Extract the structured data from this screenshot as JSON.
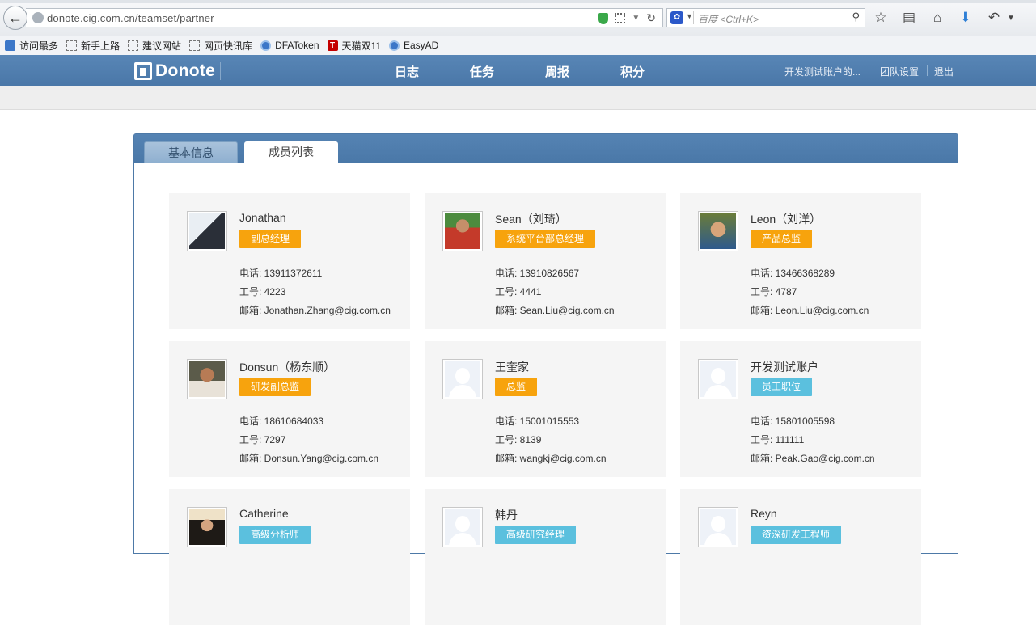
{
  "browser": {
    "url": "donote.cig.com.cn/teamset/partner",
    "search_placeholder": "百度 <Ctrl+K>"
  },
  "bookmarks": [
    "访问最多",
    "新手上路",
    "建议网站",
    "网页快讯库",
    "DFAToken",
    "天猫双11",
    "EasyAD"
  ],
  "nav": {
    "logo": "Donote",
    "items": [
      "日志",
      "任务",
      "周报",
      "积分"
    ],
    "account": "开发测试账户的...",
    "team_settings": "团队设置",
    "logout": "退出"
  },
  "tabs": {
    "basic_info": "基本信息",
    "member_list": "成员列表"
  },
  "labels": {
    "phone": "电话: ",
    "employee_id": "工号: ",
    "email": "邮箱: "
  },
  "members": [
    {
      "name": "Jonathan",
      "title": "副总经理",
      "title_color": "#f7a30d",
      "phone": "13911372611",
      "id": "4223",
      "email": "Jonathan.Zhang@cig.com.cn"
    },
    {
      "name": "Sean（刘琦）",
      "title": "系统平台部总经理",
      "title_color": "#f7a30d",
      "phone": "13910826567",
      "id": "4441",
      "email": "Sean.Liu@cig.com.cn"
    },
    {
      "name": "Leon（刘洋）",
      "title": "产品总监",
      "title_color": "#f7a30d",
      "phone": "13466368289",
      "id": "4787",
      "email": "Leon.Liu@cig.com.cn"
    },
    {
      "name": "Donsun（杨东顺）",
      "title": "研发副总监",
      "title_color": "#f7a30d",
      "phone": "18610684033",
      "id": "7297",
      "email": "Donsun.Yang@cig.com.cn"
    },
    {
      "name": "王奎家",
      "title": "总监",
      "title_color": "#f7a30d",
      "phone": "15001015553",
      "id": "8139",
      "email": "wangkj@cig.com.cn"
    },
    {
      "name": "开发测试账户",
      "title": "员工职位",
      "title_color": "#5bc0de",
      "phone": "15801005598",
      "id": "111111",
      "email": "Peak.Gao@cig.com.cn"
    },
    {
      "name": "Catherine",
      "title": "高级分析师",
      "title_color": "#5bc0de"
    },
    {
      "name": "韩丹",
      "title": "高级研究经理",
      "title_color": "#5bc0de"
    },
    {
      "name": "Reyn",
      "title": "资深研发工程师",
      "title_color": "#5bc0de"
    }
  ]
}
